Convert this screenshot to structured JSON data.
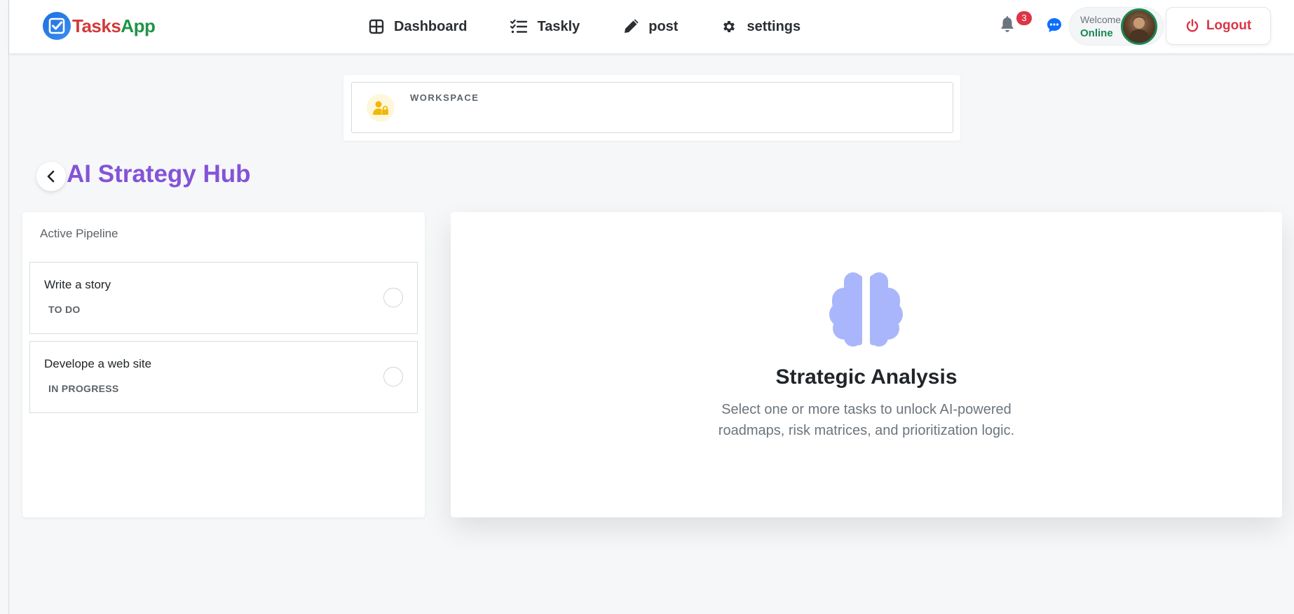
{
  "brand": {
    "part1": "Tasks",
    "part2": "App"
  },
  "nav": {
    "items": [
      {
        "label": "Dashboard",
        "icon": "dashboard-grid-icon"
      },
      {
        "label": "Taskly",
        "icon": "checklist-icon"
      },
      {
        "label": "post",
        "icon": "pencil-icon"
      },
      {
        "label": "settings",
        "icon": "gear-icon"
      }
    ],
    "notification_count": "3",
    "welcome": "Welcome",
    "status": "Online",
    "logout": "Logout"
  },
  "workspace": {
    "label": "WORKSPACE"
  },
  "page": {
    "title": "AI Strategy Hub"
  },
  "pipeline": {
    "heading": "Active Pipeline",
    "tasks": [
      {
        "name": "Write a story",
        "status": "TO DO"
      },
      {
        "name": "Develope a web site",
        "status": "IN PROGRESS"
      }
    ]
  },
  "analysis": {
    "title": "Strategic Analysis",
    "description": "Select one or more tasks to unlock AI-powered roadmaps, risk matrices, and prioritization logic."
  },
  "colors": {
    "accent_purple": "#8453d8",
    "danger": "#dc3545",
    "success": "#198754",
    "brain": "#aab6fb",
    "brand_red": "#d03a3a",
    "brand_green": "#1f9447"
  }
}
